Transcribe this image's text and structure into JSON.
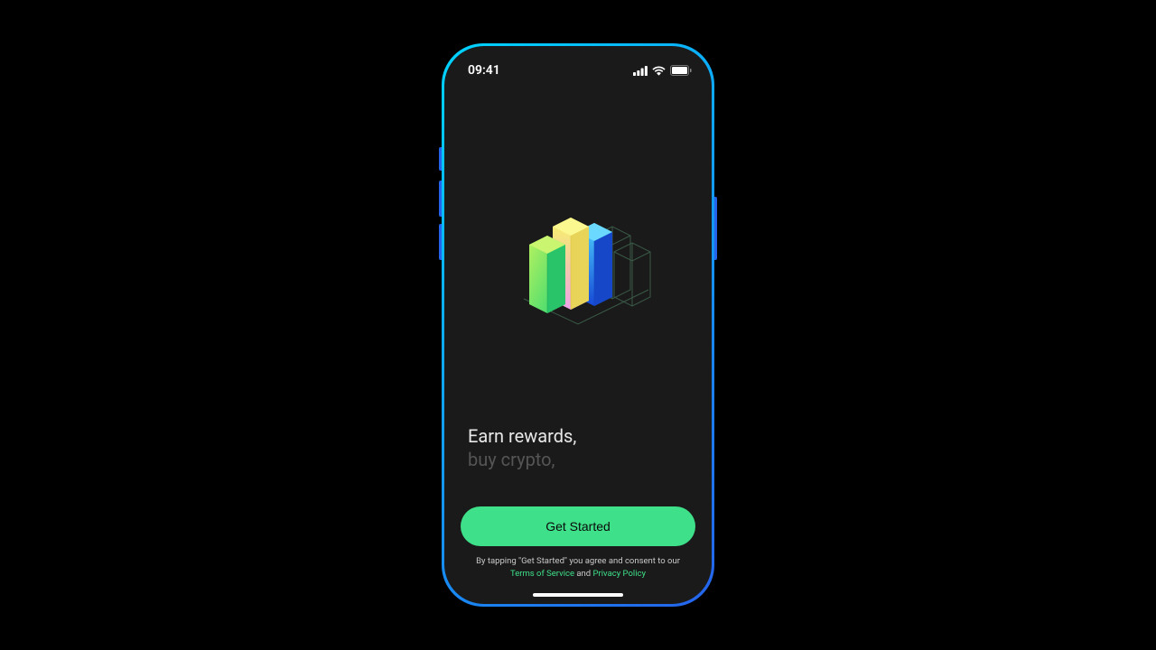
{
  "status": {
    "time": "09:41"
  },
  "tagline": {
    "primary": "Earn rewards,",
    "secondary": "buy crypto,"
  },
  "cta": {
    "label": "Get Started"
  },
  "legal": {
    "prefix": "By tapping \"Get Started\" you agree and consent to our",
    "terms": "Terms of Service",
    "and": " and ",
    "privacy": "Privacy Policy"
  },
  "colors": {
    "accent": "#3ee089",
    "frame_gradient_start": "#00d4ff",
    "frame_gradient_end": "#2563eb"
  }
}
